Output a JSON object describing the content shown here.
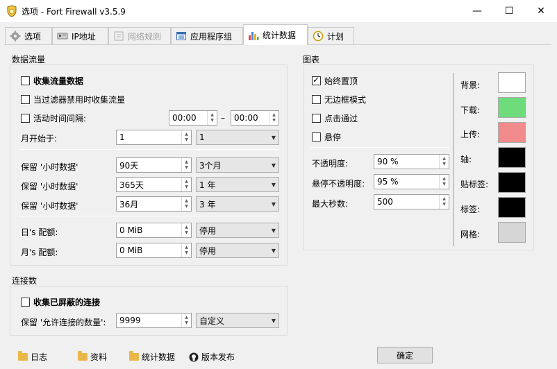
{
  "window": {
    "title": "选项 - Fort Firewall v3.5.9",
    "minimize": "—",
    "maximize": "☐",
    "close": "✕"
  },
  "tabs": [
    {
      "label": "选项"
    },
    {
      "label": "IP地址"
    },
    {
      "label": "网络规则"
    },
    {
      "label": "应用程序组"
    },
    {
      "label": "统计数据"
    },
    {
      "label": "计划"
    }
  ],
  "traffic": {
    "title": "数据流量",
    "collect": "收集流量数据",
    "collect_when_filter_disabled": "当过滤器禁用时收集流量",
    "active_period": "活动时间间隔:",
    "active_from": "00:00",
    "active_dash": "–",
    "active_to": "00:00",
    "month_start_label": "月开始于:",
    "month_start_value": "1",
    "month_start_combo": "1",
    "keep_rows": [
      {
        "label": "保留 '小时数据'",
        "value": "90天",
        "combo": "3个月"
      },
      {
        "label": "保留 '小时数据'",
        "value": "365天",
        "combo": "1 年"
      },
      {
        "label": "保留 '小时数据'",
        "value": "36月",
        "combo": "3 年"
      }
    ],
    "day_quota_label": "日's 配额:",
    "day_quota_value": "0 MiB",
    "day_quota_combo": "停用",
    "month_quota_label": "月's 配额:",
    "month_quota_value": "0 MiB",
    "month_quota_combo": "停用"
  },
  "connections": {
    "title": "连接数",
    "collect_blocked": "收集已屏蔽的连接",
    "keep_label": "保留 '允许连接的数量':",
    "keep_value": "9999",
    "keep_combo": "自定义"
  },
  "graph": {
    "title": "图表",
    "always_on_top": "始终置顶",
    "frameless": "无边框模式",
    "click_through": "点击通过",
    "hover": "悬停",
    "opacity_label": "不透明度:",
    "opacity_value": "90 %",
    "hover_opacity_label": "悬停不透明度:",
    "hover_opacity_value": "95 %",
    "max_seconds_label": "最大秒数:",
    "max_seconds_value": "500",
    "colors": [
      {
        "label": "背景:",
        "color": "#ffffff"
      },
      {
        "label": "下载:",
        "color": "#6fdc7c"
      },
      {
        "label": "上传:",
        "color": "#f28c8c"
      },
      {
        "label": "轴:",
        "color": "#000000"
      },
      {
        "label": "贴标签:",
        "color": "#000000"
      },
      {
        "label": "标签:",
        "color": "#000000"
      },
      {
        "label": "网格:",
        "color": "#d6d6d6"
      }
    ]
  },
  "footer": {
    "logs": "日志",
    "profile": "资料",
    "stats": "统计数据",
    "release": "版本发布",
    "ok": "确定"
  }
}
